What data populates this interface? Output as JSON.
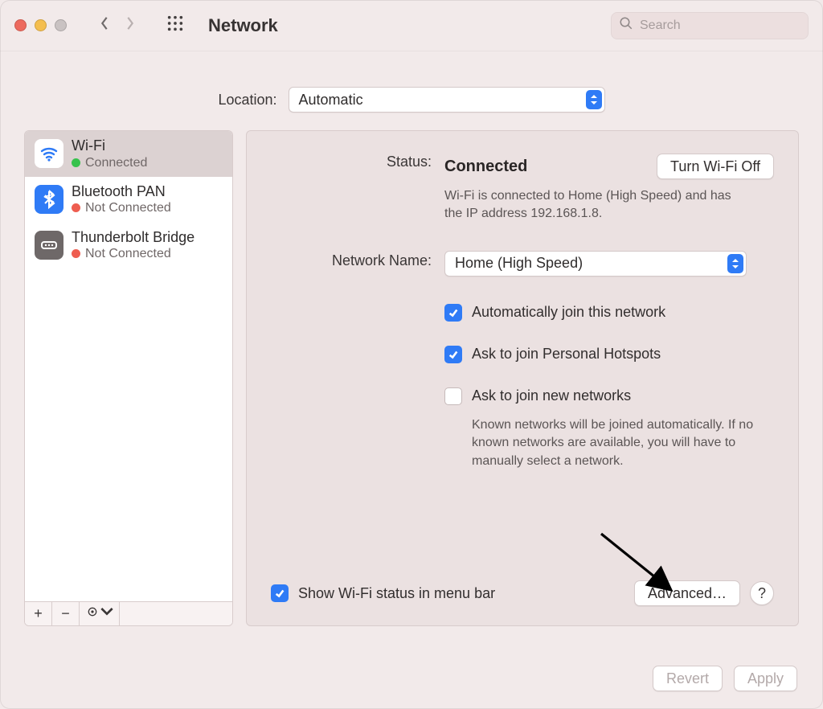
{
  "toolbar": {
    "title": "Network",
    "search_placeholder": "Search"
  },
  "location": {
    "label": "Location:",
    "value": "Automatic"
  },
  "sidebar": {
    "items": [
      {
        "name": "Wi-Fi",
        "status": "Connected",
        "dot": "green",
        "selected": true
      },
      {
        "name": "Bluetooth PAN",
        "status": "Not Connected",
        "dot": "red",
        "selected": false
      },
      {
        "name": "Thunderbolt Bridge",
        "status": "Not Connected",
        "dot": "red",
        "selected": false
      }
    ],
    "footer": {
      "add": "+",
      "remove": "−",
      "gear": "⊙"
    }
  },
  "detail": {
    "status_label": "Status:",
    "status_value": "Connected",
    "wifi_toggle": "Turn Wi-Fi Off",
    "status_desc": "Wi-Fi is connected to Home (High Speed) and has the IP address 192.168.1.8.",
    "network_name_label": "Network Name:",
    "network_name_value": "Home (High Speed)",
    "checkboxes": {
      "auto_join": {
        "checked": true,
        "label": "Automatically join this network"
      },
      "ask_hotspot": {
        "checked": true,
        "label": "Ask to join Personal Hotspots"
      },
      "ask_new": {
        "checked": false,
        "label": "Ask to join new networks",
        "note": "Known networks will be joined automatically. If no known networks are available, you will have to manually select a network."
      }
    },
    "menubar": {
      "checked": true,
      "label": "Show Wi-Fi status in menu bar"
    },
    "advanced": "Advanced…",
    "help": "?"
  },
  "actions": {
    "revert": "Revert",
    "apply": "Apply"
  }
}
